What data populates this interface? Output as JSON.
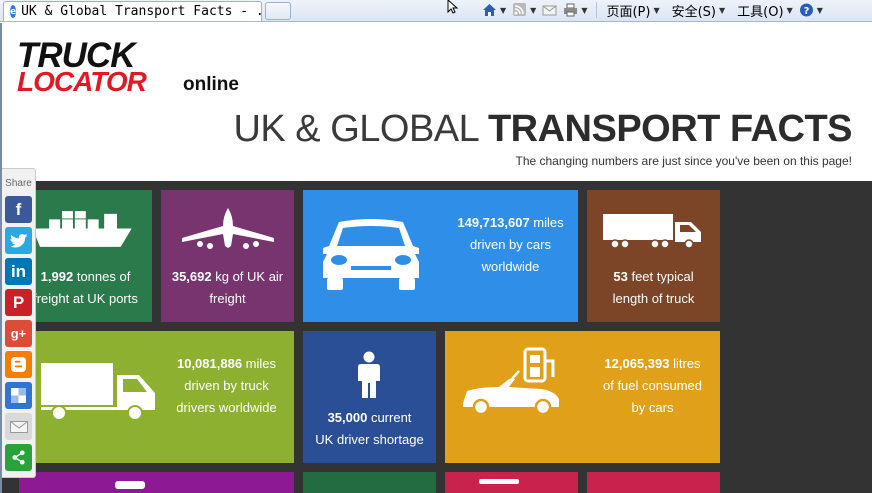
{
  "browser": {
    "tab_title": "UK & Global Transport Facts  - ...",
    "commands": {
      "page": "页面(P)",
      "safety": "安全(S)",
      "tools": "工具(O)"
    }
  },
  "header": {
    "logo_truck": "TRUCK",
    "logo_locator": "LOCATOR",
    "logo_online": "online",
    "title_light": "UK & GLOBAL ",
    "title_bold": "TRANSPORT FACTS",
    "subtitle": "The changing numbers are just since you've been on this page!"
  },
  "share": {
    "label": "Share",
    "buttons": [
      "facebook",
      "twitter",
      "linkedin",
      "pinterest",
      "google-plus",
      "blogger",
      "delicious",
      "email",
      "sharethis"
    ]
  },
  "tiles": {
    "ports": {
      "value": "1,992",
      "text_1": " tonnes of",
      "text_2": "freight at UK ports",
      "color": "#2a7a4c"
    },
    "air": {
      "value": "35,692",
      "text_1": " kg of UK air",
      "text_2": "freight",
      "color": "#77346f"
    },
    "cars_miles": {
      "value": "149,713,607",
      "text_1": " miles",
      "text_2": "driven by cars",
      "text_3": "worldwide",
      "color": "#2e8ee8"
    },
    "truck_length": {
      "value": "53",
      "text_1": " feet typical",
      "text_2": "length of truck",
      "color": "#7c4528"
    },
    "truck_miles": {
      "value": "10,081,886",
      "text_1": " miles",
      "text_2": "driven by truck",
      "text_3": "drivers worldwide",
      "color": "#8eb031"
    },
    "drivers": {
      "value": "35,000",
      "text_1": " current",
      "text_2": "UK driver shortage",
      "color": "#2a4f96"
    },
    "fuel": {
      "value": "12,065,393",
      "text_1": " litres",
      "text_2": "of fuel consumed",
      "text_3": "by cars",
      "color": "#e0a019"
    },
    "row3": [
      {
        "color": "#8e1a93"
      },
      {
        "color": "#236b40"
      },
      {
        "color": "#c8224d"
      }
    ]
  }
}
